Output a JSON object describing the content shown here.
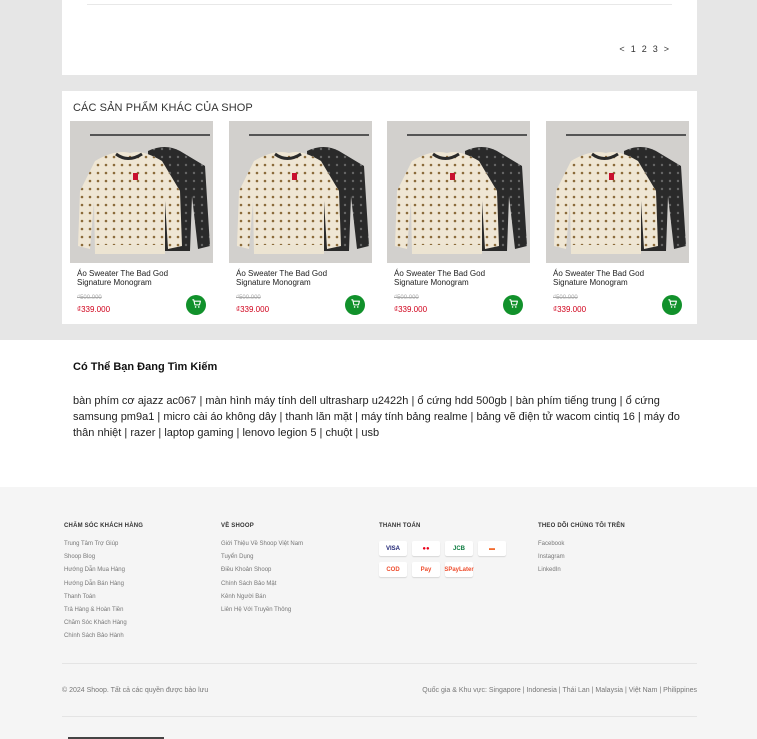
{
  "pagination": {
    "prev": "<",
    "pages": [
      "1",
      "2",
      "3"
    ],
    "next": ">"
  },
  "shop_section": {
    "title": "CÁC SẢN PHẨM KHÁC CỦA SHOP",
    "products": [
      {
        "name": "Áo Sweater The Bad God Signature Monogram",
        "old_price": "₫500.000",
        "price": "₫339.000"
      },
      {
        "name": "Áo Sweater The Bad God Signature Monogram",
        "old_price": "₫500.000",
        "price": "₫339.000"
      },
      {
        "name": "Áo Sweater The Bad God Signature Monogram",
        "old_price": "₫500.000",
        "price": "₫339.000"
      },
      {
        "name": "Áo Sweater The Bad God Signature Monogram",
        "old_price": "₫500.000",
        "price": "₫339.000"
      }
    ]
  },
  "search_section": {
    "title": "Có Thể Bạn Đang Tìm Kiếm",
    "terms": [
      "bàn phím cơ ajazz ac067",
      "màn hình máy tính dell ultrasharp u2422h",
      "ổ cứng hdd 500gb",
      "bàn phím tiếng trung",
      "ổ cứng samsung pm9a1",
      "micro cài áo không dây",
      "thanh lăn mặt",
      "máy tính bảng realme",
      "bảng vẽ điện tử wacom cintiq 16",
      "máy đo thân nhiệt",
      "razer",
      "laptop gaming",
      "lenovo legion 5",
      "chuột",
      "usb"
    ]
  },
  "footer": {
    "customer_care": {
      "title": "CHĂM SÓC KHÁCH HÀNG",
      "items": [
        "Trung Tâm Trợ Giúp",
        "Shoop Blog",
        "Hướng Dẫn Mua Hàng",
        "Hướng Dẫn Bán Hàng",
        "Thanh Toán",
        "Trả Hàng & Hoàn Tiền",
        "Chăm Sóc Khách Hàng",
        "Chính Sách Bảo Hành"
      ]
    },
    "about": {
      "title": "VỀ SHOOP",
      "items": [
        "Giới Thiệu Về Shoop Việt Nam",
        "Tuyển Dụng",
        "Điều Khoản Shoop",
        "Chính Sách Bảo Mật",
        "Kênh Người Bán",
        "Liên Hệ Với Truyền Thông"
      ]
    },
    "payment": {
      "title": "THANH TOÁN",
      "methods": [
        {
          "label": "VISA",
          "color": "#1a1f71"
        },
        {
          "label": "●●",
          "color": "#eb001b"
        },
        {
          "label": "JCB",
          "color": "#0b7a3e"
        },
        {
          "label": "▬",
          "color": "#f26a2e"
        },
        {
          "label": "COD",
          "color": "#ee4d2d"
        },
        {
          "label": "Pay",
          "color": "#ee4d2d"
        },
        {
          "label": "SPayLater",
          "color": "#ee4d2d"
        }
      ]
    },
    "follow": {
      "title": "THEO DÕI CHÚNG TÔI TRÊN",
      "items": [
        "Facebook",
        "Instagram",
        "LinkedIn"
      ]
    },
    "copyright": "© 2024 Shoop. Tất cả các quyền được bảo lưu",
    "countries_label": "Quốc gia & Khu vực:",
    "countries": [
      "Singapore",
      "Indonesia",
      "Thái Lan",
      "Malaysia",
      "Việt Nam",
      "Philippines"
    ]
  },
  "colors": {
    "accent_green": "#11912b",
    "price_red": "#d0011b"
  }
}
